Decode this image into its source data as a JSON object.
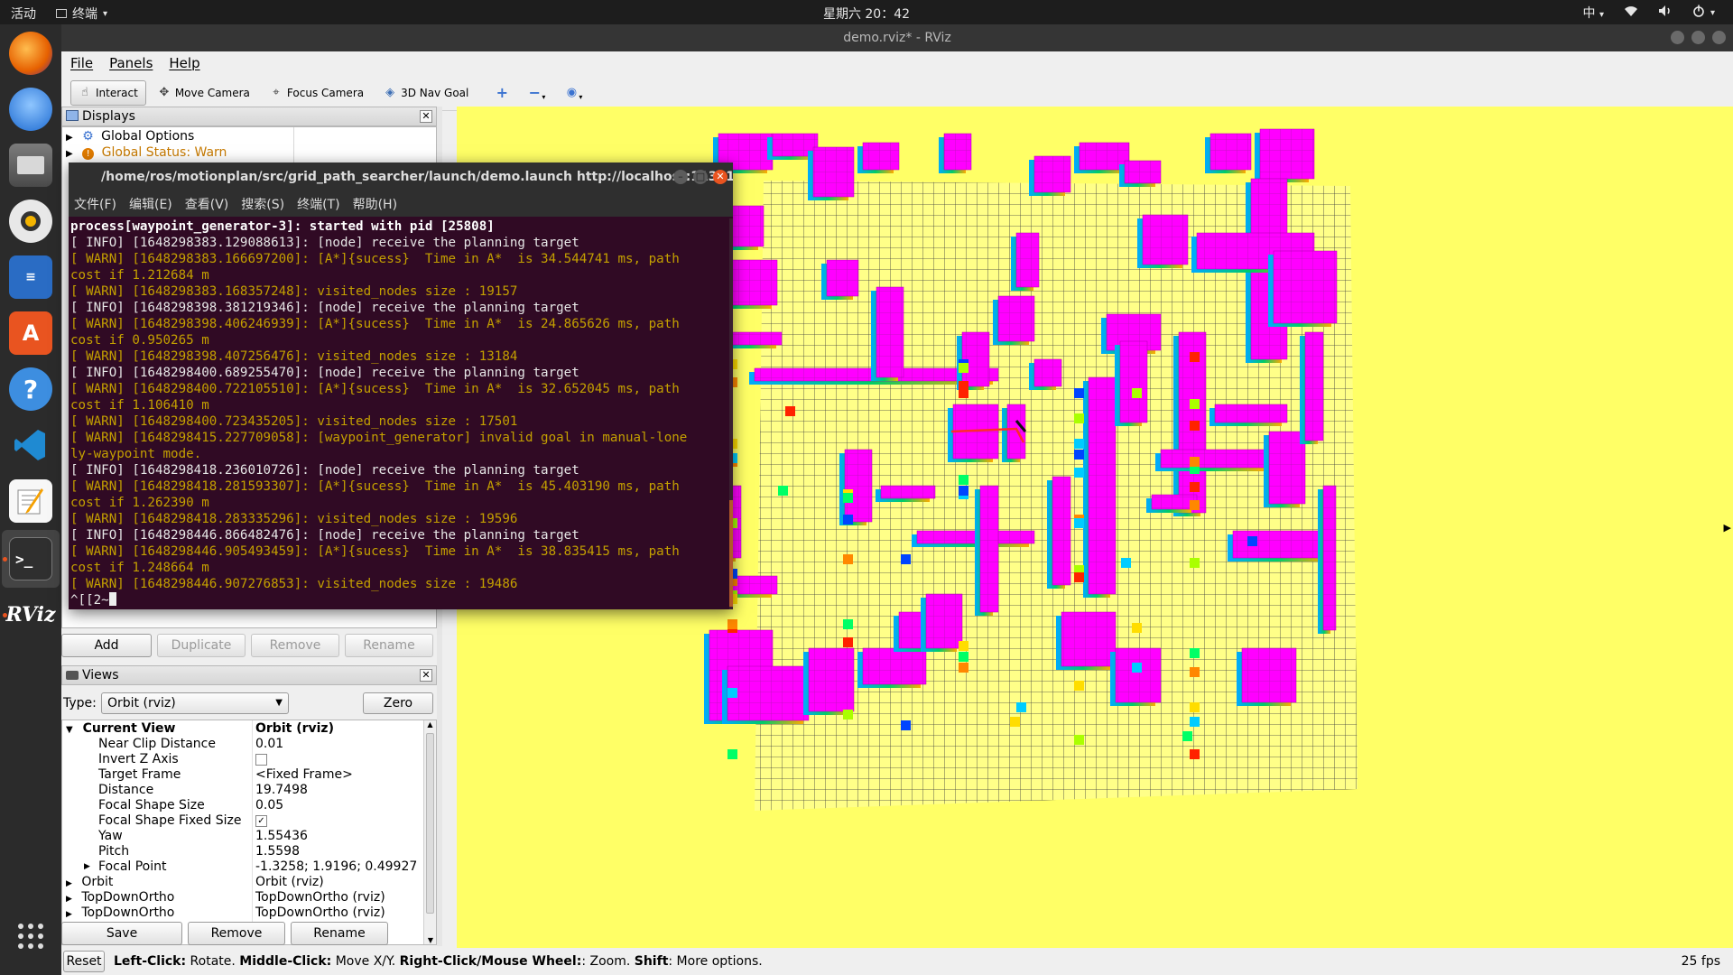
{
  "topbar": {
    "activities": "活动",
    "app": "终端",
    "clock": "星期六 20：42",
    "input_method": "中"
  },
  "window": {
    "title": "demo.rviz* - RViz"
  },
  "menu": {
    "file": "File",
    "panels": "Panels",
    "help": "Help"
  },
  "toolbar": {
    "interact": "Interact",
    "move_camera": "Move Camera",
    "focus_camera": "Focus Camera",
    "nav_goal": "3D Nav Goal"
  },
  "displays": {
    "title": "Displays",
    "global_options": "Global Options",
    "global_status": "Global Status: Warn",
    "buttons": {
      "add": "Add",
      "duplicate": "Duplicate",
      "remove": "Remove",
      "rename": "Rename"
    }
  },
  "views": {
    "title": "Views",
    "type_label": "Type:",
    "type_value": "Orbit (rviz)",
    "zero": "Zero",
    "current_view": {
      "name": "Current View",
      "value": "Orbit (rviz)"
    },
    "props": [
      {
        "name": "Near Clip Distance",
        "value": "0.01"
      },
      {
        "name": "Invert Z Axis",
        "value": ""
      },
      {
        "name": "Target Frame",
        "value": "<Fixed Frame>"
      },
      {
        "name": "Distance",
        "value": "19.7498"
      },
      {
        "name": "Focal Shape Size",
        "value": "0.05"
      },
      {
        "name": "Focal Shape Fixed Size",
        "value": "✓"
      },
      {
        "name": "Yaw",
        "value": "1.55436"
      },
      {
        "name": "Pitch",
        "value": "1.5598"
      },
      {
        "name": "Focal Point",
        "value": "-1.3258; 1.9196; 0.49927"
      }
    ],
    "saved": [
      {
        "name": "Orbit",
        "value": "Orbit (rviz)"
      },
      {
        "name": "TopDownOrtho",
        "value": "TopDownOrtho (rviz)"
      },
      {
        "name": "TopDownOrtho",
        "value": "TopDownOrtho (rviz)"
      }
    ],
    "buttons": {
      "save": "Save",
      "remove": "Remove",
      "rename": "Rename"
    }
  },
  "status": {
    "reset": "Reset",
    "left_click": "Left-Click:",
    "left_click_desc": " Rotate. ",
    "middle_click": "Middle-Click:",
    "middle_click_desc": " Move X/Y. ",
    "right_click": "Right-Click/Mouse Wheel:",
    "right_click_desc": ": Zoom. ",
    "shift": "Shift",
    "shift_desc": ": More options.",
    "fps": "25 fps"
  },
  "terminal": {
    "title": "/home/ros/motionplan/src/grid_path_searcher/launch/demo.launch http://localhost:11311",
    "menu": [
      "文件(F)",
      "编辑(E)",
      "查看(V)",
      "搜索(S)",
      "终端(T)",
      "帮助(H)"
    ],
    "lines": [
      {
        "type": "bold",
        "text": "process[waypoint_generator-3]: started with pid [25808]"
      },
      {
        "type": "info",
        "text": "[ INFO] [1648298383.129088613]: [node] receive the planning target"
      },
      {
        "type": "warn",
        "text": "[ WARN] [1648298383.166697200]: [A*]{sucess}  Time in A*  is 34.544741 ms, path"
      },
      {
        "type": "warn",
        "text": "cost if 1.212684 m"
      },
      {
        "type": "warn",
        "text": "[ WARN] [1648298383.168357248]: visited_nodes size : 19157"
      },
      {
        "type": "info",
        "text": "[ INFO] [1648298398.381219346]: [node] receive the planning target"
      },
      {
        "type": "warn",
        "text": "[ WARN] [1648298398.406246939]: [A*]{sucess}  Time in A*  is 24.865626 ms, path"
      },
      {
        "type": "warn",
        "text": "cost if 0.950265 m"
      },
      {
        "type": "warn",
        "text": "[ WARN] [1648298398.407256476]: visited_nodes size : 13184"
      },
      {
        "type": "info",
        "text": "[ INFO] [1648298400.689255470]: [node] receive the planning target"
      },
      {
        "type": "warn",
        "text": "[ WARN] [1648298400.722105510]: [A*]{sucess}  Time in A*  is 32.652045 ms, path"
      },
      {
        "type": "warn",
        "text": "cost if 1.106410 m"
      },
      {
        "type": "warn",
        "text": "[ WARN] [1648298400.723435205]: visited_nodes size : 17501"
      },
      {
        "type": "warn",
        "text": "[ WARN] [1648298415.227709058]: [waypoint_generator] invalid goal in manual-lone"
      },
      {
        "type": "warn",
        "text": "ly-waypoint mode."
      },
      {
        "type": "info",
        "text": "[ INFO] [1648298418.236010726]: [node] receive the planning target"
      },
      {
        "type": "warn",
        "text": "[ WARN] [1648298418.281593307]: [A*]{sucess}  Time in A*  is 45.403190 ms, path"
      },
      {
        "type": "warn",
        "text": "cost if 1.262390 m"
      },
      {
        "type": "warn",
        "text": "[ WARN] [1648298418.283335296]: visited_nodes size : 19596"
      },
      {
        "type": "info",
        "text": "[ INFO] [1648298446.866482476]: [node] receive the planning target"
      },
      {
        "type": "warn",
        "text": "[ WARN] [1648298446.905493459]: [A*]{sucess}  Time in A*  is 38.835415 ms, path"
      },
      {
        "type": "warn",
        "text": "cost if 1.248664 m"
      },
      {
        "type": "warn",
        "text": "[ WARN] [1648298446.907276853]: visited_nodes size : 19486"
      },
      {
        "type": "info",
        "text": "^[[2~"
      }
    ]
  },
  "colors": {
    "obstacle": "#ff00ff",
    "background": "#ffff66",
    "grid": "#333333",
    "terminal_bg": "#300a24",
    "warn": "#c4a000",
    "accent": "#e95420"
  }
}
